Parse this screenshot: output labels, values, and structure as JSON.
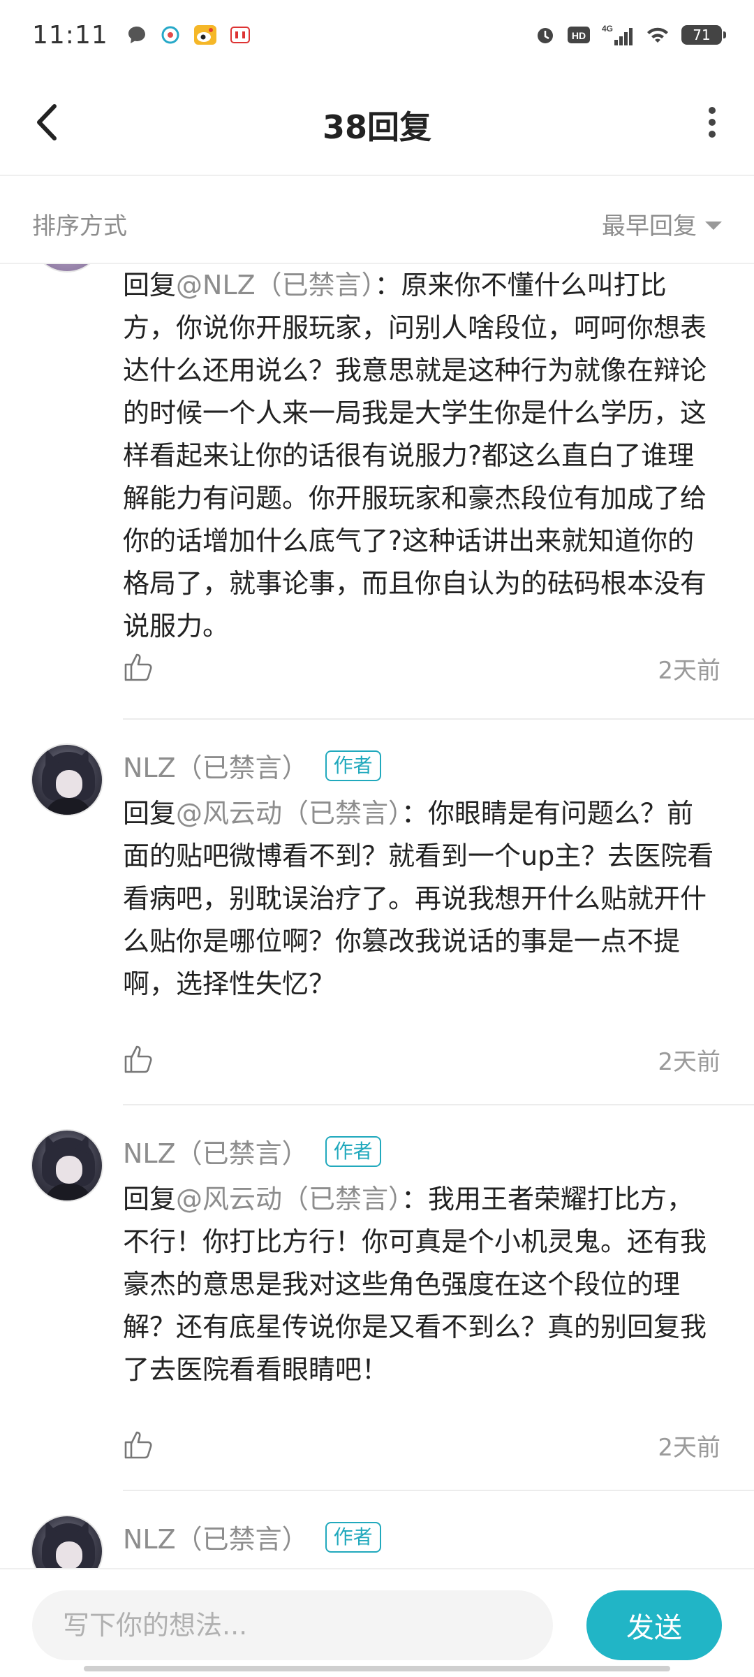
{
  "status_bar": {
    "time": "11:11",
    "network": "4G",
    "hd": "HD",
    "battery": "71",
    "icons": [
      "chat-bubble-icon",
      "app-icon-1",
      "weibo-icon",
      "app-icon-2",
      "alarm-icon",
      "hd-icon",
      "signal-icon",
      "wifi-icon",
      "battery-icon"
    ]
  },
  "header": {
    "title": "38回复",
    "back_icon": "chevron-left-icon",
    "more_icon": "more-vertical-icon"
  },
  "sort": {
    "label": "排序方式",
    "selected": "最早回复"
  },
  "comments": [
    {
      "username": "",
      "badge": "",
      "mention": "@NLZ（已禁言）",
      "reply_prefix": "回复",
      "text": "：原来你不懂什么叫打比方，你说你开服玩家，问别人啥段位，呵呵你想表达什么还用说么？我意思就是这种行为就像在辩论的时候一个人来一局我是大学生你是什么学历，这样看起来让你的话很有说服力?都这么直白了谁理解能力有问题。你开服玩家和豪杰段位有加成了给你的话增加什么底气了?这种话讲出来就知道你的格局了，就事论事，而且你自认为的砝码根本没有说服力。",
      "time": "2天前"
    },
    {
      "username": "NLZ（已禁言）",
      "badge": "作者",
      "reply_prefix": "回复",
      "mention": "@风云动（已禁言）",
      "text": "：你眼睛是有问题么？前面的贴吧微博看不到？就看到一个up主？去医院看看病吧，别耽误治疗了。再说我想开什么贴就开什么贴你是哪位啊？你篡改我说话的事是一点不提啊，选择性失忆？",
      "time": "2天前"
    },
    {
      "username": "NLZ（已禁言）",
      "badge": "作者",
      "reply_prefix": "回复",
      "mention": "@风云动（已禁言）",
      "text": "：我用王者荣耀打比方，不行！你打比方行！你可真是个小机灵鬼。还有我豪杰的意思是我对这些角色强度在这个段位的理解？还有底星传说你是又看不到么？真的别回复我了去医院看看眼睛吧！",
      "time": "2天前"
    },
    {
      "username": "NLZ（已禁言）",
      "badge": "作者",
      "reply_prefix": "",
      "mention": "",
      "text": "",
      "time": ""
    }
  ],
  "composer": {
    "placeholder": "写下你的想法...",
    "send_label": "发送"
  },
  "colors": {
    "accent": "#21b5c6",
    "badge": "#21a9bd",
    "muted_text": "#8d8d8d",
    "body_text": "#222222"
  }
}
